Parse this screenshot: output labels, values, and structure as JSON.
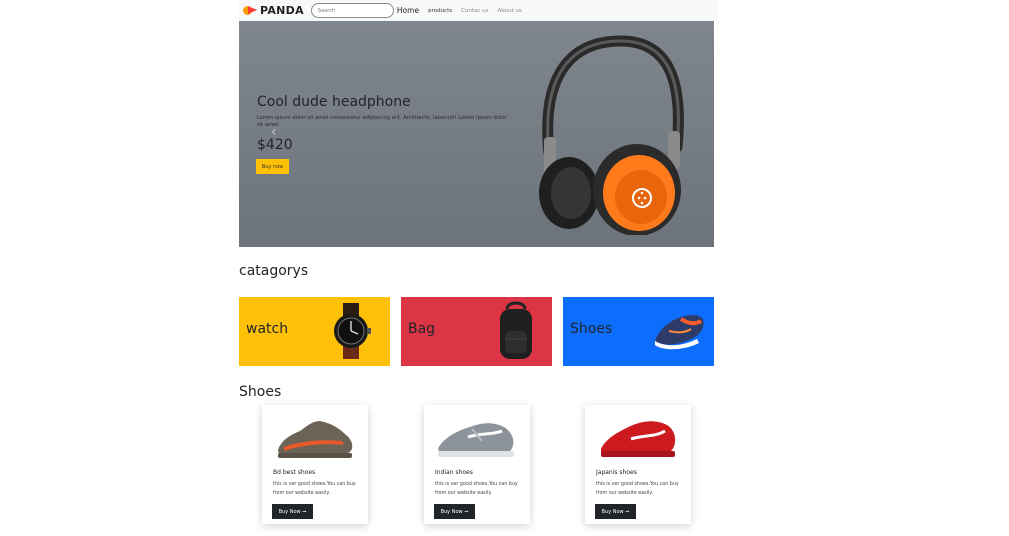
{
  "navbar": {
    "brand": "PANDA",
    "search_placeholder": "Search",
    "home": "Home",
    "products": "products",
    "contact": "Contac us",
    "about": "About us"
  },
  "hero": {
    "title": "Cool dude headphone",
    "description": "Lorem ipsum dolor sit amet consectetur adipisicing elit. Architecto, laborum! Lorem ipsum dolor sit amet.",
    "price": "$420",
    "button": "Buy now",
    "prev_icon": "chevron-left",
    "next_icon": "chevron-right"
  },
  "categories": {
    "heading": "catagorys",
    "items": [
      {
        "label": "watch",
        "color": "#ffc107"
      },
      {
        "label": "Bag",
        "color": "#dc3545"
      },
      {
        "label": "Shoes",
        "color": "#0d6efd"
      }
    ]
  },
  "products": {
    "heading": "Shoes",
    "items": [
      {
        "title": "Bd best shoes",
        "text": "this is ver good shoes.You can buy from our website easily.",
        "button": "Buy Now ➞"
      },
      {
        "title": "Indian shoes",
        "text": "this is ver good shoes.You can buy from our website easily.",
        "button": "Buy Now ➞"
      },
      {
        "title": "Japanis shoes",
        "text": "this is ver good shoes.You can buy from our website easily.",
        "button": "Buy Now ➞"
      }
    ]
  }
}
